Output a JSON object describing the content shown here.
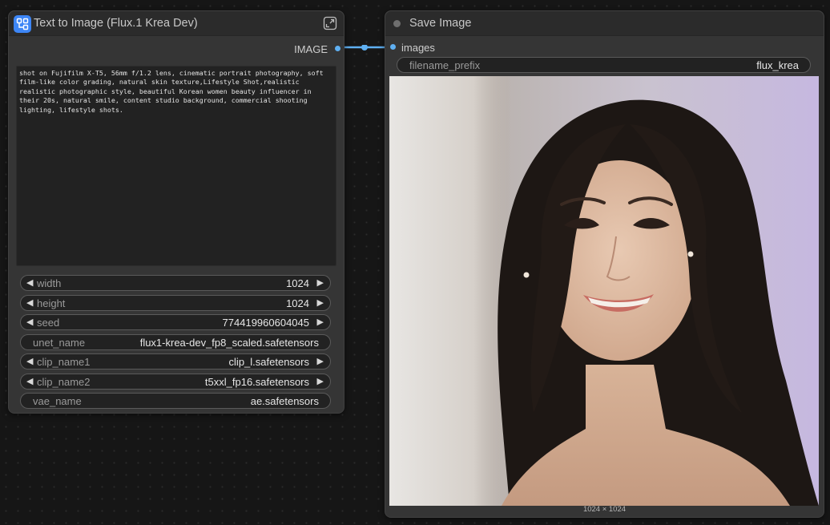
{
  "text_to_image_node": {
    "title": "Text to Image (Flux.1 Krea Dev)",
    "output_label": "IMAGE",
    "prompt": "shot on Fujifilm X-T5, 56mm f/1.2 lens, cinematic portrait photography, soft film-like color grading, natural skin texture,Lifestyle Shot,realistic realistic photographic style, beautiful Korean women beauty influencer in their 20s, natural smile, content studio background, commercial shooting lighting, lifestyle shots.",
    "widgets": [
      {
        "label": "width",
        "value": "1024"
      },
      {
        "label": "height",
        "value": "1024"
      },
      {
        "label": "seed",
        "value": "774419960604045"
      },
      {
        "label": "unet_name",
        "value": "flux1-krea-dev_fp8_scaled.safetensors"
      },
      {
        "label": "clip_name1",
        "value": "clip_l.safetensors"
      },
      {
        "label": "clip_name2",
        "value": "t5xxl_fp16.safetensors"
      },
      {
        "label": "vae_name",
        "value": "ae.safetensors"
      }
    ]
  },
  "save_image_node": {
    "title": "Save Image",
    "input_label": "images",
    "filename_prefix_label": "filename_prefix",
    "filename_prefix_value": "flux_krea",
    "image_size": "1024 × 1024"
  },
  "colors": {
    "canvas": "#161616",
    "node_body": "#353535",
    "node_header": "#2b2b2b",
    "link": "#5fb0f2",
    "icon_accent": "#3d86f6"
  },
  "icons": {
    "node_icon": "node-app-icon",
    "expand": "expand-icon",
    "status": "status-dot-icon"
  }
}
